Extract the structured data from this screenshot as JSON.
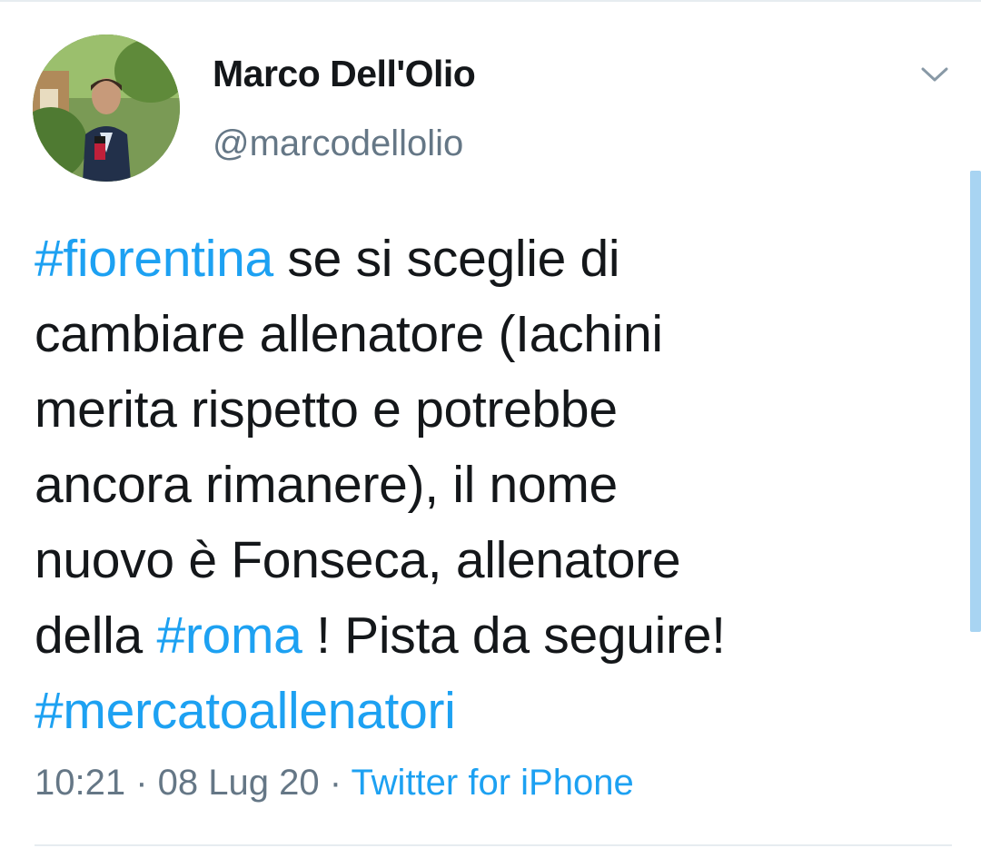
{
  "author": {
    "name": "Marco Dell'Olio",
    "handle": "@marcodellolio"
  },
  "tweet": {
    "line1": {
      "tag": "#fiorentina",
      "text": " se si sceglie di"
    },
    "line2": "cambiare allenatore (Iachini",
    "line3": "merita rispetto e potrebbe",
    "line4": "ancora rimanere), il nome",
    "line5": "nuovo è Fonseca, allenatore",
    "line6": {
      "pre": "della ",
      "tag": "#roma",
      "post": " ! Pista da seguire!"
    },
    "line7": {
      "tag": "#mercatoallenatori"
    }
  },
  "meta": {
    "time": "10:21",
    "sep1": " · ",
    "date": "08 Lug 20",
    "sep2": " · ",
    "source": "Twitter for iPhone"
  },
  "icons": {
    "more": "chevron-down-icon"
  },
  "colors": {
    "link": "#1da1f2",
    "text": "#14171a",
    "secondary": "#657786",
    "divider": "#e6ecf0",
    "scrollbar": "#a8d4f2"
  }
}
